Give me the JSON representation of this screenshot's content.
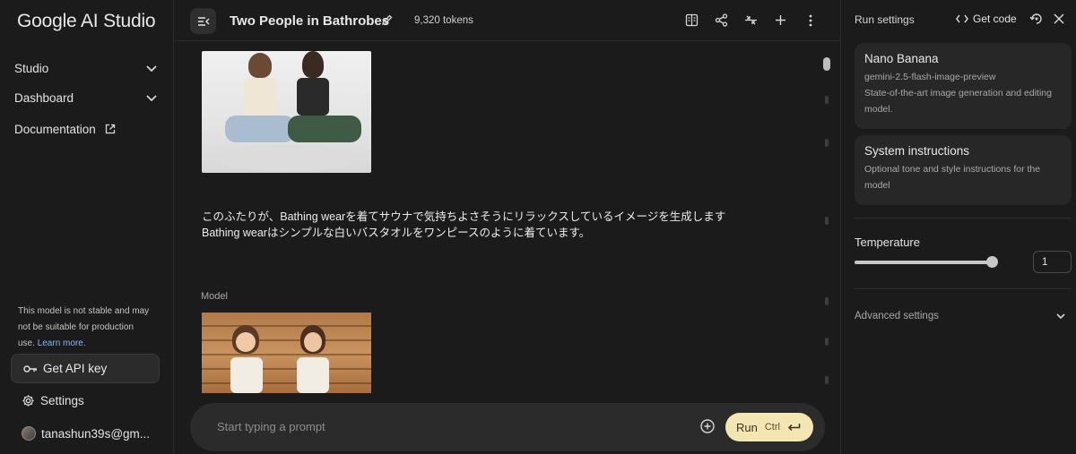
{
  "sidebar": {
    "logo": "Google AI Studio",
    "items": [
      {
        "label": "Studio"
      },
      {
        "label": "Dashboard"
      },
      {
        "label": "Documentation"
      }
    ],
    "warning_text": "This model is not stable and may not be suitable for production use.",
    "warning_link": "Learn more.",
    "api_key_label": "Get API key",
    "settings_label": "Settings",
    "account_label": "tanashun39s@gm..."
  },
  "header": {
    "title": "Two People in Bathrobes",
    "tokens": "9,320 tokens"
  },
  "chat": {
    "user_message_line1": "このふたりが、Bathing wearを着てサウナで気持ちよさそうにリラックスしているイメージを生成します",
    "user_message_line2": "Bathing wearはシンプルな白いバスタオルをワンピースのように着ています。",
    "model_label": "Model"
  },
  "prompt": {
    "placeholder": "Start typing a prompt",
    "run_label": "Run",
    "run_shortcut": "Ctrl"
  },
  "run_settings": {
    "title": "Run settings",
    "get_code": "Get code",
    "model_card": {
      "name": "Nano Banana",
      "id": "gemini-2.5-flash-image-preview",
      "description": "State-of-the-art image generation and editing model."
    },
    "system_card": {
      "title": "System instructions",
      "description": "Optional tone and style instructions for the model"
    },
    "temperature_label": "Temperature",
    "temperature_value": "1",
    "temperature_fraction": 1.0,
    "advanced_label": "Advanced settings"
  },
  "colors": {
    "background": "#1b1b1b",
    "run_button": "#f3e6b3",
    "link": "#8ab4f8"
  }
}
